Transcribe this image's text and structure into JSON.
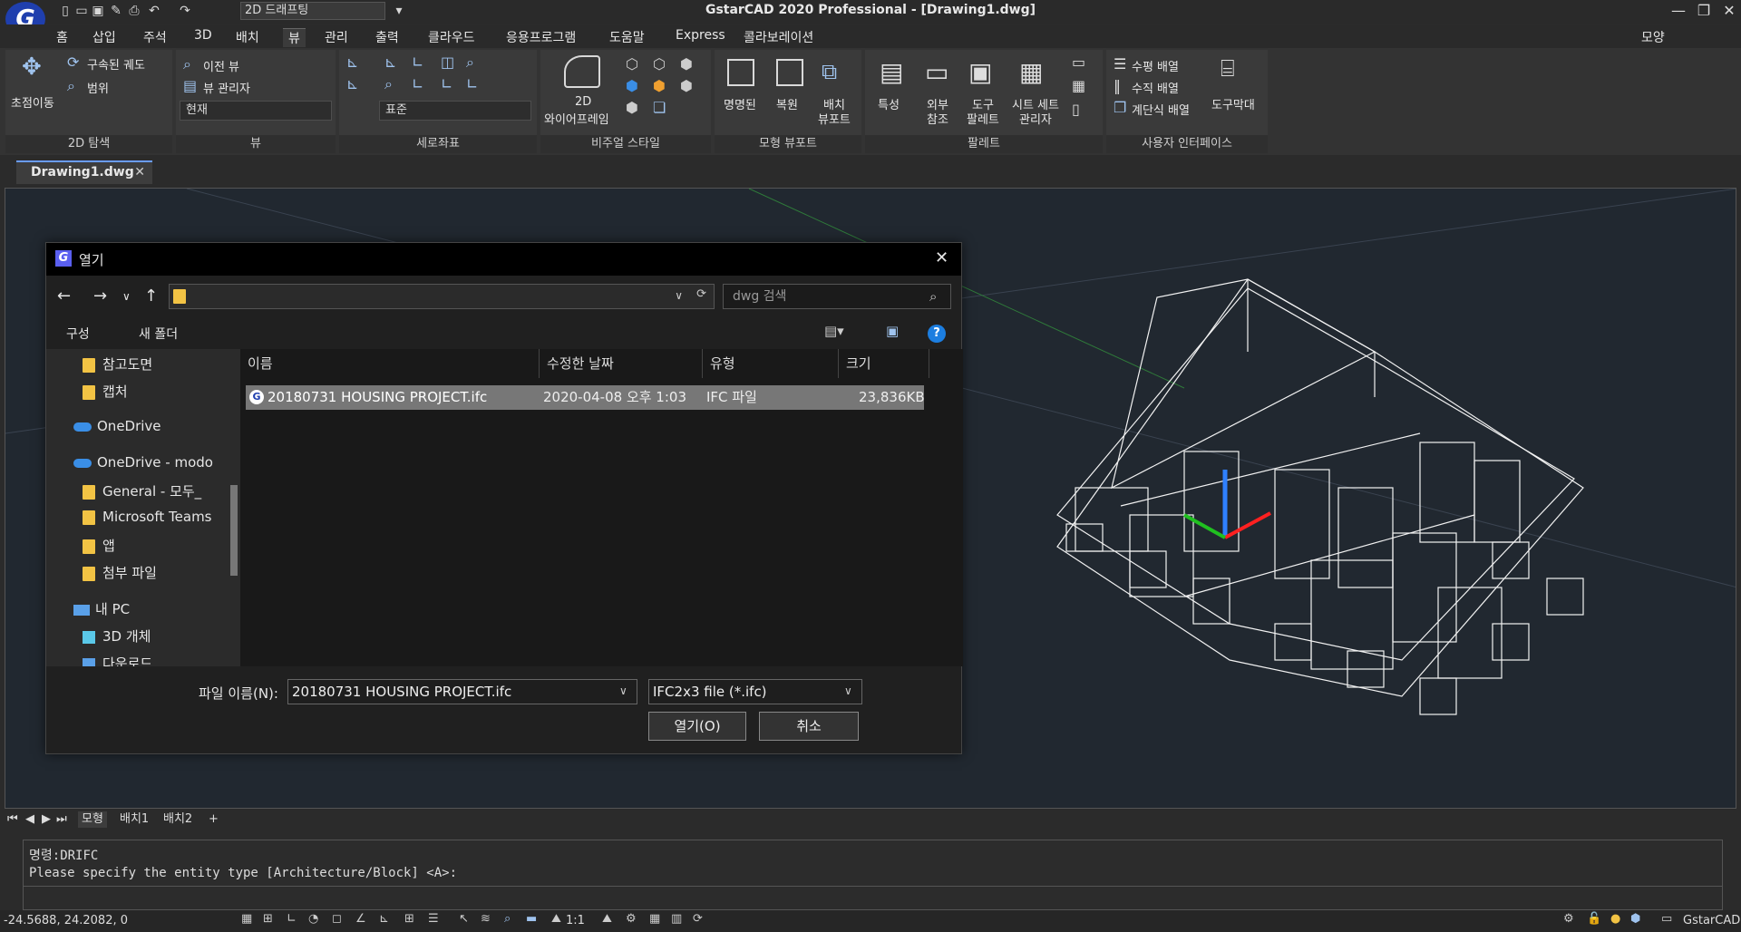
{
  "title_bar": {
    "window_title": "GstarCAD 2020 Professional - [Drawing1.dwg]",
    "workspace": "2D 드래프팅",
    "logo_letter": "G"
  },
  "menu": [
    "홈",
    "삽입",
    "주석",
    "3D",
    "배치",
    "뷰",
    "관리",
    "출력",
    "클라우드",
    "응용프로그램",
    "도움말",
    "Express",
    "콜라보레이션"
  ],
  "menu_right": "모양",
  "ribbon": {
    "nav2d": {
      "pan": "초점이동",
      "orbit": "구속된 궤도",
      "range": "범위",
      "title": "2D 탐색"
    },
    "view": {
      "prev": "이전 뷰",
      "manager": "뷰 관리자",
      "current": "현재",
      "title": "뷰"
    },
    "ucs": {
      "combo": "표준",
      "title": "세로좌표"
    },
    "visual": {
      "wire_line1": "2D",
      "wire_line2": "와이어프레임",
      "title": "비주얼 스타일"
    },
    "model_vp": {
      "named": "명명된",
      "restore": "복원",
      "layout_l1": "배치",
      "layout_l2": "뷰포트",
      "title": "모형 뷰포트"
    },
    "palette": {
      "props": "특성",
      "xref_l1": "외부",
      "xref_l2": "참조",
      "tool_l1": "도구",
      "tool_l2": "팔레트",
      "sheet_l1": "시트 세트",
      "sheet_l2": "관리자",
      "title": "팔레트"
    },
    "ui": {
      "horiz": "수평 배열",
      "vert": "수직 배열",
      "cascade": "계단식 배열",
      "toolbar": "도구막대",
      "title": "사용자 인터페이스"
    }
  },
  "doc_tab": "Drawing1.dwg",
  "layout_tabs": [
    "모형",
    "배치1",
    "배치2",
    "+"
  ],
  "command_lines": [
    "명령:DRIFC",
    "Please specify the entity type [Architecture/Block] <A>:"
  ],
  "status": {
    "coords": "-24.5688, 24.2082, 0",
    "scale": "1:1",
    "app": "GstarCAD"
  },
  "dialog": {
    "title": "열기",
    "search_placeholder": "dwg 검색",
    "organize": "구성",
    "new_folder": "새 폴더",
    "nav_items": [
      "참고도면",
      "캡처",
      "OneDrive",
      "OneDrive - modo",
      "General - 모두_",
      "Microsoft Teams",
      "앱",
      "첨부 파일",
      "내 PC",
      "3D 개체",
      "다운로드"
    ],
    "columns": [
      "이름",
      "수정한 날짜",
      "유형",
      "크기"
    ],
    "files": [
      {
        "name": "20180731 HOUSING PROJECT.ifc",
        "date": "2020-04-08 오후 1:03",
        "type": "IFC 파일",
        "size": "23,836KB"
      }
    ],
    "filename_label": "파일 이름(N):",
    "filename_value": "20180731 HOUSING PROJECT.ifc",
    "filetype_value": "IFC2x3 file (*.ifc)",
    "open_button": "열기(O)",
    "cancel_button": "취소"
  },
  "colors": {
    "accent": "#1f3fae",
    "canvas_bg": "#212830",
    "selection": "#777777"
  }
}
